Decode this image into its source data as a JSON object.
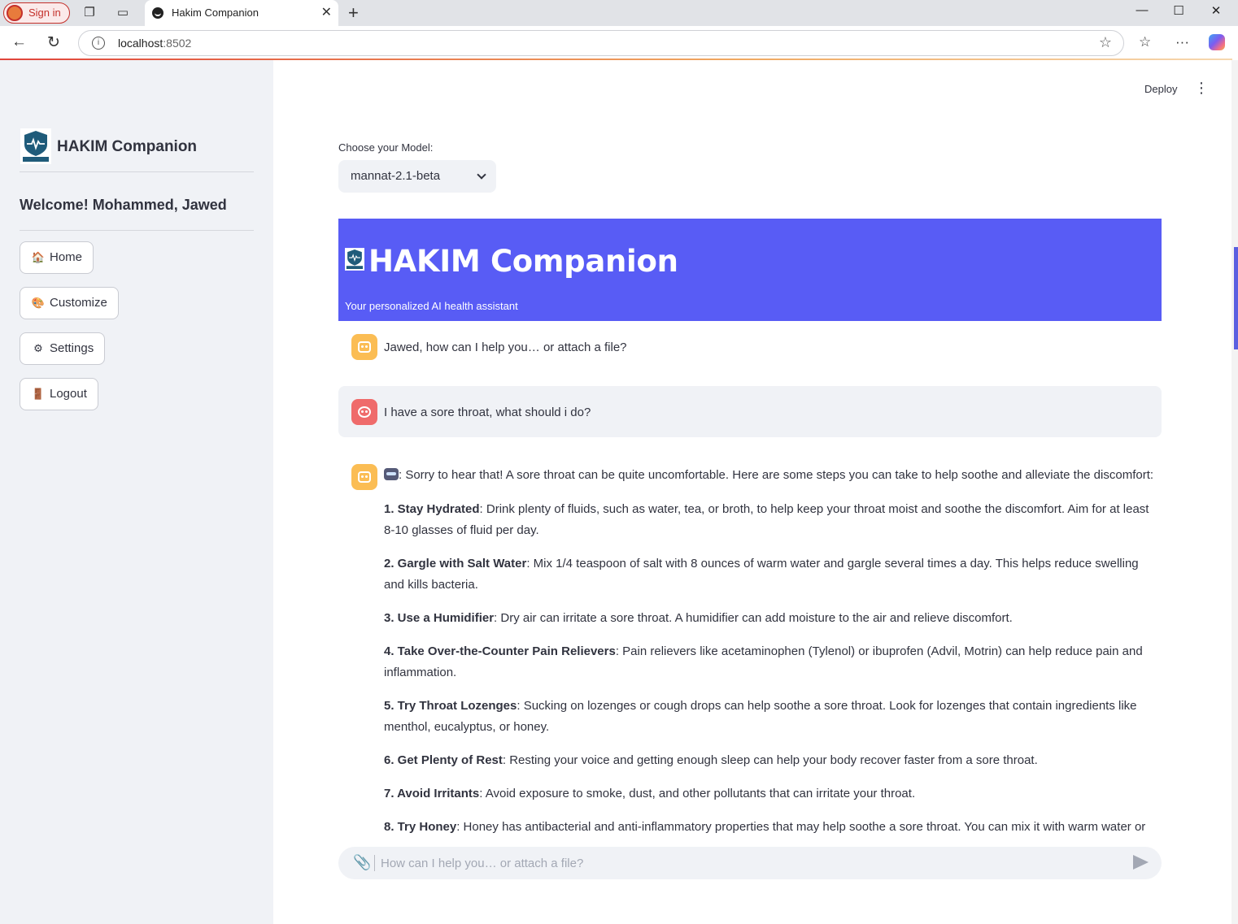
{
  "browser": {
    "signin_label": "Sign in",
    "tab_title": "Hakim Companion",
    "url_host": "localhost",
    "url_port": ":8502"
  },
  "header": {
    "deploy_label": "Deploy"
  },
  "sidebar": {
    "title": "HAKIM Companion",
    "welcome": "Welcome! Mohammed, Jawed",
    "buttons": [
      {
        "label": "Home",
        "icon": "🏠"
      },
      {
        "label": "Customize",
        "icon": "🎨"
      },
      {
        "label": "Settings",
        "icon": "⚙"
      },
      {
        "label": "Logout",
        "icon": "🚪"
      }
    ]
  },
  "model": {
    "label": "Choose your Model:",
    "selected": "mannat-2.1-beta"
  },
  "banner": {
    "title": "HAKIM Companion",
    "subtitle": "Your personalized AI health assistant"
  },
  "chat": {
    "greeting": "Jawed, how can I help you… or attach a file?",
    "user_message": "I have a sore throat, what should i do?",
    "answer_intro": ": Sorry to hear that! A sore throat can be quite uncomfortable. Here are some steps you can take to help soothe and alleviate the discomfort:",
    "steps": [
      {
        "title": "1. Stay Hydrated",
        "text": ": Drink plenty of fluids, such as water, tea, or broth, to help keep your throat moist and soothe the discomfort. Aim for at least 8-10 glasses of fluid per day."
      },
      {
        "title": "2. Gargle with Salt Water",
        "text": ": Mix 1/4 teaspoon of salt with 8 ounces of warm water and gargle several times a day. This helps reduce swelling and kills bacteria."
      },
      {
        "title": "3. Use a Humidifier",
        "text": ": Dry air can irritate a sore throat. A humidifier can add moisture to the air and relieve discomfort."
      },
      {
        "title": "4. Take Over-the-Counter Pain Relievers",
        "text": ": Pain relievers like acetaminophen (Tylenol) or ibuprofen (Advil, Motrin) can help reduce pain and inflammation."
      },
      {
        "title": "5. Try Throat Lozenges",
        "text": ": Sucking on lozenges or cough drops can help soothe a sore throat. Look for lozenges that contain ingredients like menthol, eucalyptus, or honey."
      },
      {
        "title": "6. Get Plenty of Rest",
        "text": ": Resting your voice and getting enough sleep can help your body recover faster from a sore throat."
      },
      {
        "title": "7. Avoid Irritants",
        "text": ": Avoid exposure to smoke, dust, and other pollutants that can irritate your throat."
      },
      {
        "title": "8. Try Honey",
        "text": ": Honey has antibacterial and anti-inflammatory properties that may help soothe a sore throat. You can mix it with warm water or"
      }
    ],
    "input_placeholder": "How can I help you… or attach a file?"
  },
  "colors": {
    "banner": "#585cf5",
    "sidebar_bg": "#f0f2f6",
    "bot_avatar": "#fbbd54",
    "user_avatar": "#ef6b6b"
  }
}
